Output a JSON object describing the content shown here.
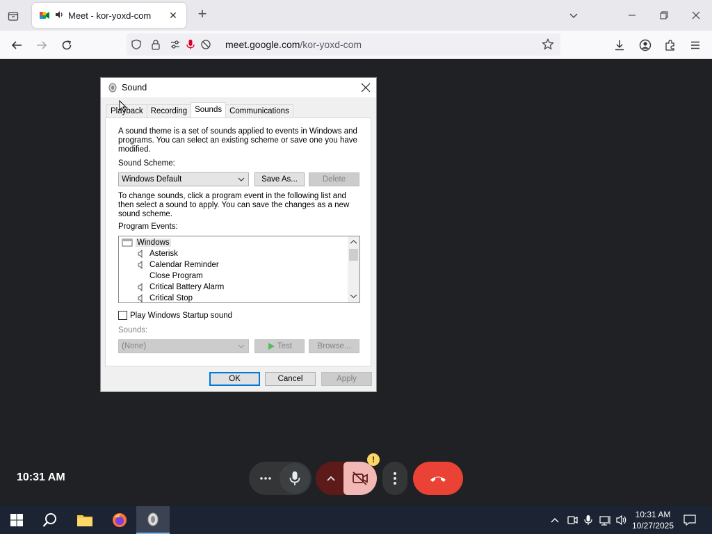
{
  "browser": {
    "tab_title": "Meet - kor-yoxd-com",
    "url_domain": "meet.google.com",
    "url_path": "/kor-yoxd-com",
    "tab_close": "✕",
    "new_tab": "+"
  },
  "meet": {
    "clock": "10:31 AM",
    "camera_warning": "!"
  },
  "dialog": {
    "title": "Sound",
    "tabs": [
      "Playback",
      "Recording",
      "Sounds",
      "Communications"
    ],
    "active_tab": "Sounds",
    "intro": "A sound theme is a set of sounds applied to events in Windows and programs.  You can select an existing scheme or save one you have modified.",
    "scheme_label": "Sound Scheme:",
    "scheme_value": "Windows Default",
    "save_as": "Save As...",
    "delete": "Delete",
    "instructions": "To change sounds, click a program event in the following list and then select a sound to apply.  You can save the changes as a new sound scheme.",
    "events_label": "Program Events:",
    "events": [
      {
        "label": "Windows",
        "level": 0,
        "has_sound": false
      },
      {
        "label": "Asterisk",
        "level": 1,
        "has_sound": true
      },
      {
        "label": "Calendar Reminder",
        "level": 1,
        "has_sound": true
      },
      {
        "label": "Close Program",
        "level": 1,
        "has_sound": false
      },
      {
        "label": "Critical Battery Alarm",
        "level": 1,
        "has_sound": true
      },
      {
        "label": "Critical Stop",
        "level": 1,
        "has_sound": true
      }
    ],
    "startup_checkbox": "Play Windows Startup sound",
    "sounds_label": "Sounds:",
    "sounds_value": "(None)",
    "test": "Test",
    "browse": "Browse...",
    "ok": "OK",
    "cancel": "Cancel",
    "apply": "Apply"
  },
  "taskbar": {
    "time": "10:31 AM",
    "date": "10/27/2025"
  },
  "colors": {
    "meet_bg": "#202124",
    "end_call": "#ea4335",
    "camera_off": "#f2b8b5",
    "accent": "#0078d7"
  }
}
